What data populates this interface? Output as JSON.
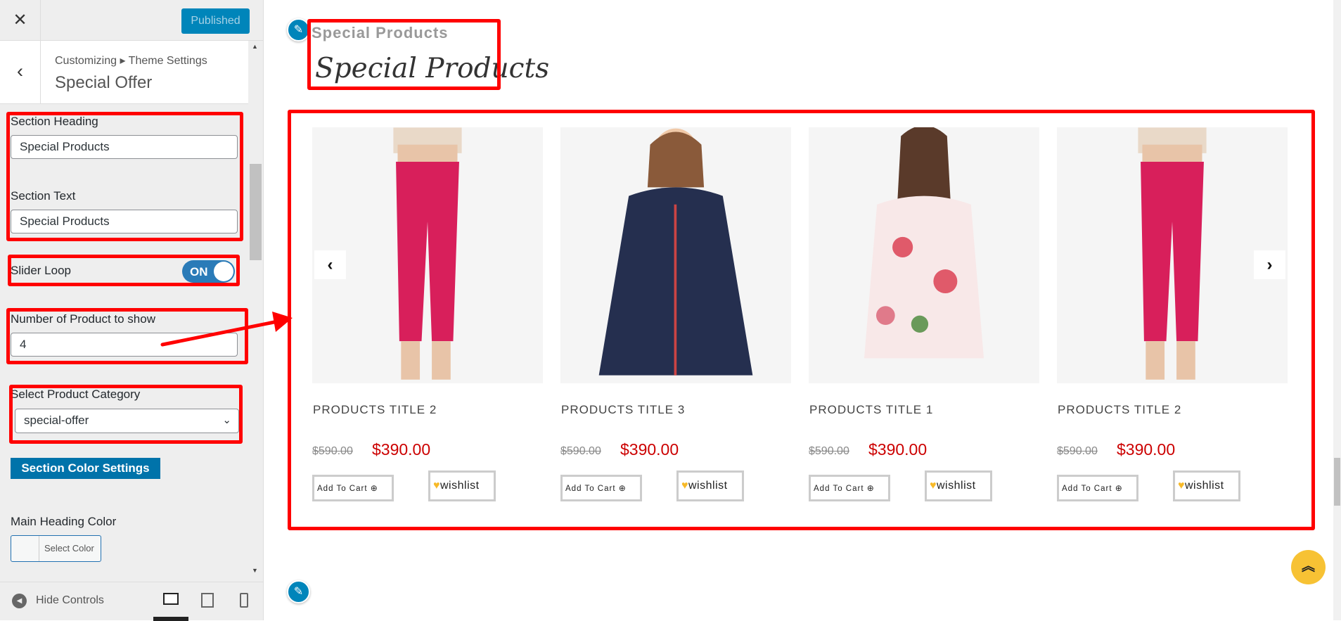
{
  "sidebar": {
    "close_icon": "close-icon",
    "publish_label": "Published",
    "breadcrumb": "Customizing ▸ Theme Settings",
    "panel_title": "Special Offer",
    "section_heading": {
      "label": "Section Heading",
      "value": "Special Products"
    },
    "section_text": {
      "label": "Section Text",
      "value": "Special Products"
    },
    "slider_loop": {
      "label": "Slider Loop",
      "state": "ON"
    },
    "product_count": {
      "label": "Number of Product to show",
      "value": "4"
    },
    "category": {
      "label": "Select Product Category",
      "value": "special-offer"
    },
    "color_settings_button": "Section Color Settings",
    "main_heading_color": {
      "label": "Main Heading Color",
      "button": "Select Color"
    },
    "hide_controls": "Hide Controls",
    "devices": [
      "desktop",
      "tablet",
      "mobile"
    ],
    "active_device": "desktop"
  },
  "preview": {
    "subheading": "Special Products",
    "heading": "Special Products",
    "products": [
      {
        "title": "PRODUCTS TITLE 2",
        "old_price": "$590.00",
        "price": "$390.00",
        "cart": "Add To Cart",
        "wishlist": "wishlist",
        "image": "pink-trousers"
      },
      {
        "title": "PRODUCTS TITLE 3",
        "old_price": "$590.00",
        "price": "$390.00",
        "cart": "Add To Cart",
        "wishlist": "wishlist",
        "image": "navy-jacket"
      },
      {
        "title": "PRODUCTS TITLE 1",
        "old_price": "$590.00",
        "price": "$390.00",
        "cart": "Add To Cart",
        "wishlist": "wishlist",
        "image": "floral-blouse"
      },
      {
        "title": "PRODUCTS TITLE 2",
        "old_price": "$590.00",
        "price": "$390.00",
        "cart": "Add To Cart",
        "wishlist": "wishlist",
        "image": "pink-trousers"
      }
    ]
  },
  "colors": {
    "accent": "#0085ba",
    "price": "#cc0000",
    "highlight": "#ff0000",
    "back_to_top": "#f7c234"
  }
}
